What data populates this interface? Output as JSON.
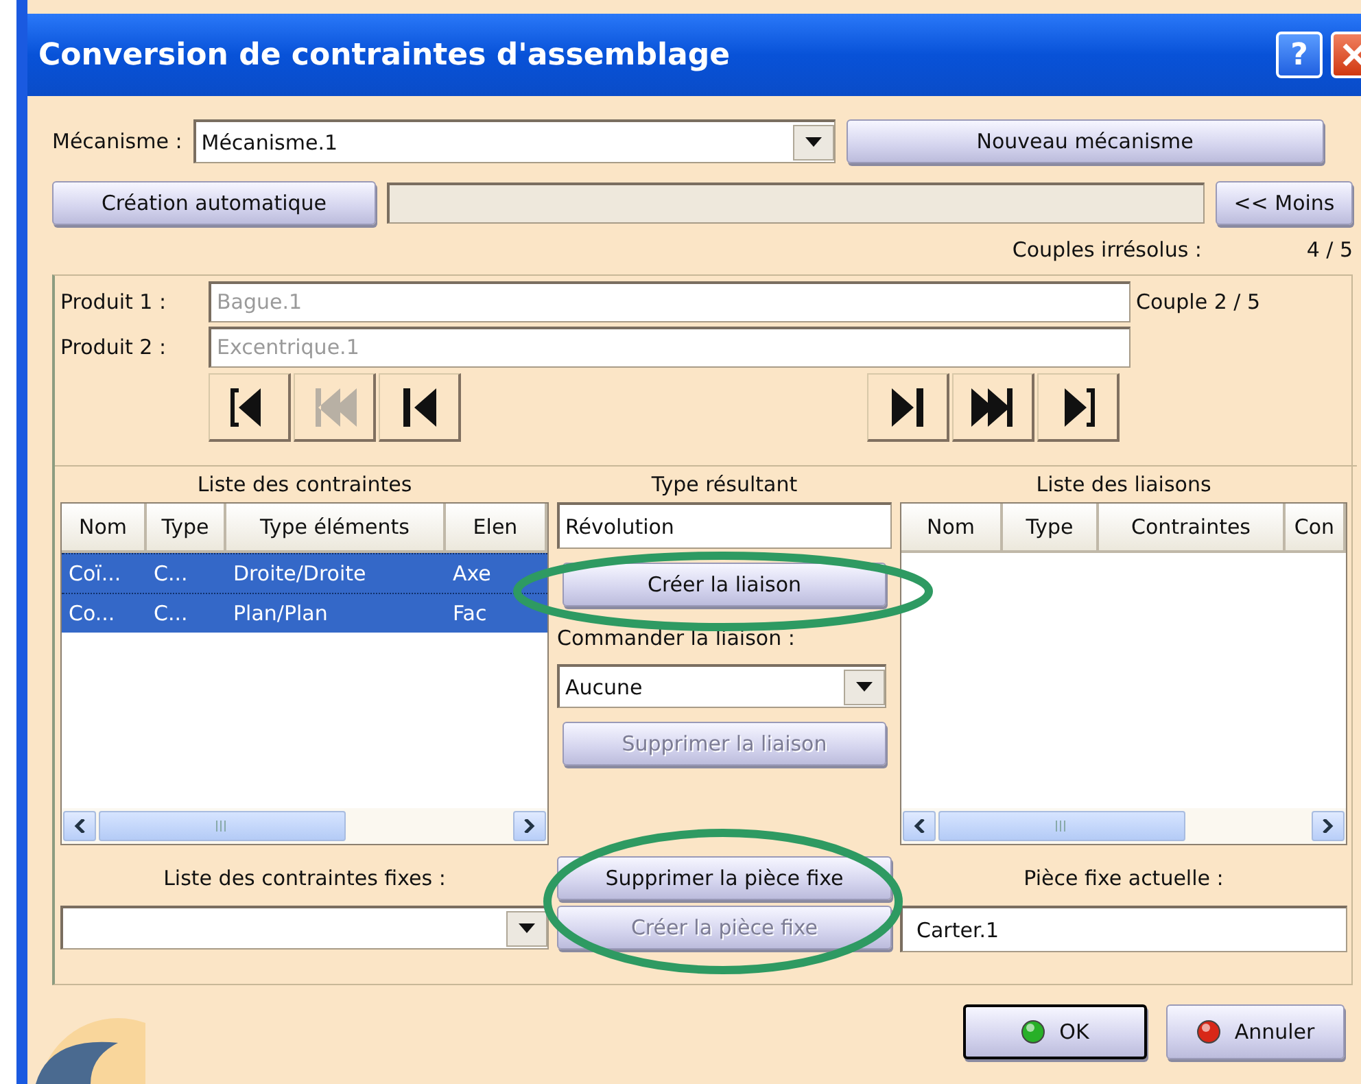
{
  "window": {
    "title": "Conversion de contraintes d'assemblage",
    "help": "?"
  },
  "mechanism": {
    "label": "Mécanisme :",
    "value": "Mécanisme.1",
    "new_button": "Nouveau mécanisme"
  },
  "auto": {
    "button": "Création automatique",
    "toggle": "<< Moins"
  },
  "unresolved": {
    "label": "Couples irrésolus :",
    "value": "4 / 5"
  },
  "products": [
    {
      "label": "Produit 1 :",
      "value": "Bague.1"
    },
    {
      "label": "Produit 2 :",
      "value": "Excentrique.1"
    }
  ],
  "couple": "Couple 2 / 5",
  "nav": [
    {
      "kind": "first",
      "disabled": false
    },
    {
      "kind": "fast-back",
      "disabled": true
    },
    {
      "kind": "back",
      "disabled": false
    },
    {
      "kind": "forward",
      "disabled": false
    },
    {
      "kind": "fast-forward",
      "disabled": false
    },
    {
      "kind": "last",
      "disabled": false
    }
  ],
  "constraints": {
    "title": "Liste des contraintes",
    "columns": [
      "Nom",
      "Type",
      "Type éléments",
      "Elen"
    ],
    "rows": [
      {
        "cells": [
          "Coï...",
          "C...",
          "Droite/Droite",
          "Axe"
        ],
        "selected": true
      },
      {
        "cells": [
          "Co...",
          "C...",
          "Plan/Plan",
          "Fac"
        ],
        "selected": true
      }
    ]
  },
  "result": {
    "title": "Type résultant",
    "value": "Révolution",
    "create_button": {
      "label": "Créer la liaison",
      "disabled": false
    },
    "command_label": "Commander la liaison :",
    "command_value": "Aucune",
    "delete_button": {
      "label": "Supprimer la liaison",
      "disabled": true
    }
  },
  "liaisons": {
    "title": "Liste des liaisons",
    "columns": [
      "Nom",
      "Type",
      "Contraintes",
      "Con"
    ]
  },
  "fixed": {
    "label": "Liste des contraintes fixes :",
    "delete_button": {
      "label": "Supprimer la pièce fixe",
      "disabled": false
    },
    "create_button": {
      "label": "Créer la pièce fixe",
      "disabled": true
    },
    "current_label": "Pièce fixe actuelle :",
    "current_value": "Carter.1"
  },
  "footer": [
    {
      "kind": "ok",
      "label": "OK",
      "default": true
    },
    {
      "kind": "cancel",
      "label": "Annuler",
      "default": false
    }
  ]
}
